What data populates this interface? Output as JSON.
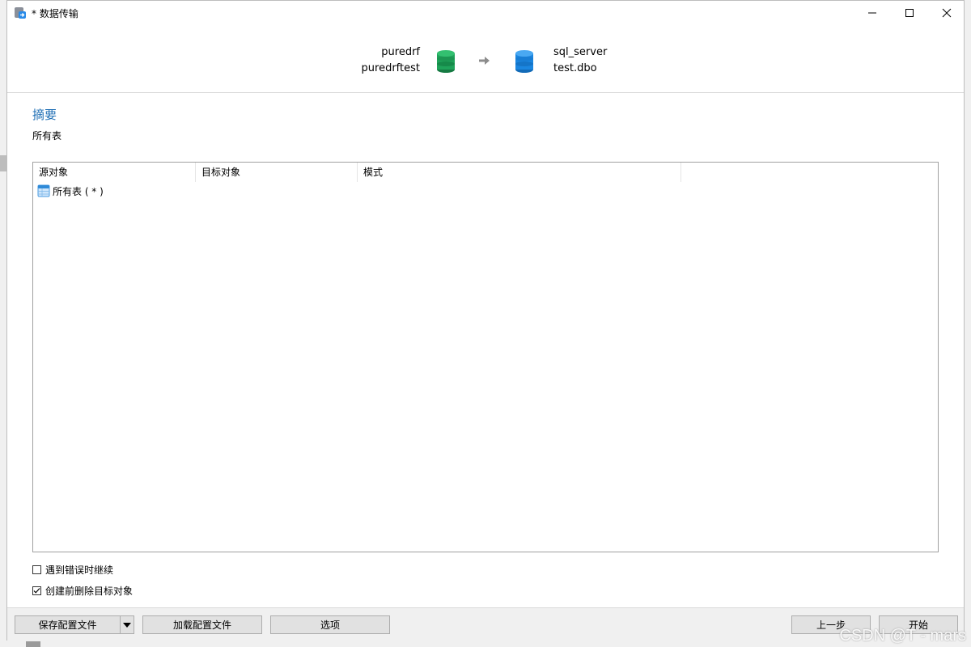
{
  "window": {
    "title": "* 数据传输"
  },
  "transfer": {
    "source_connection": "puredrf",
    "source_database": "puredrftest",
    "target_connection": "sql_server",
    "target_schema": "test.dbo",
    "source_color": "#1fa35a",
    "target_color": "#1b86e0"
  },
  "summary": {
    "title": "摘要",
    "subtitle": "所有表",
    "columns": [
      "源对象",
      "目标对象",
      "模式"
    ],
    "rows": [
      {
        "source": "所有表 ( * )",
        "target": "",
        "mode": ""
      }
    ]
  },
  "options": {
    "continue_on_error": {
      "label": "遇到错误时继续",
      "checked": false
    },
    "drop_before_create": {
      "label": "创建前删除目标对象",
      "checked": true
    }
  },
  "footer": {
    "save_profile": "保存配置文件",
    "load_profile": "加载配置文件",
    "options": "选项",
    "previous": "上一步",
    "start": "开始"
  },
  "watermark": "CSDN @T - mars"
}
